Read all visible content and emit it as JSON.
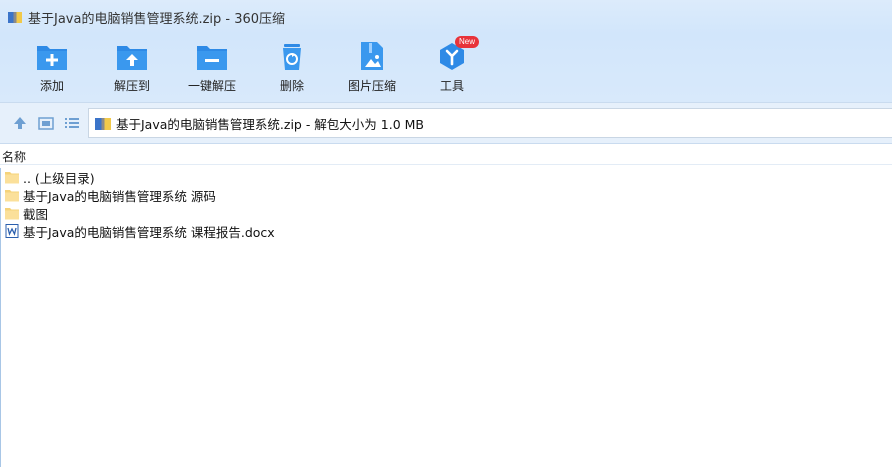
{
  "window": {
    "title": "基于Java的电脑销售管理系统.zip - 360压缩"
  },
  "toolbar": {
    "items": [
      {
        "label": "添加",
        "icon": "add-icon"
      },
      {
        "label": "解压到",
        "icon": "extract-to-icon"
      },
      {
        "label": "一键解压",
        "icon": "one-click-extract-icon"
      },
      {
        "label": "删除",
        "icon": "delete-icon"
      },
      {
        "label": "图片压缩",
        "icon": "image-compress-icon"
      },
      {
        "label": "工具",
        "icon": "tools-icon",
        "badge": "New"
      }
    ]
  },
  "addressbar": {
    "text": "基于Java的电脑销售管理系统.zip - 解包大小为 1.0 MB"
  },
  "list": {
    "header": "名称",
    "items": [
      {
        "name": ".. (上级目录)",
        "type": "folder"
      },
      {
        "name": "基于Java的电脑销售管理系统 源码",
        "type": "folder"
      },
      {
        "name": "截图",
        "type": "folder"
      },
      {
        "name": "基于Java的电脑销售管理系统 课程报告.docx",
        "type": "word"
      }
    ]
  },
  "colors": {
    "accent": "#2e8ae6",
    "toolbar_bg": "#d2e6fb",
    "badge": "#e8333a"
  }
}
